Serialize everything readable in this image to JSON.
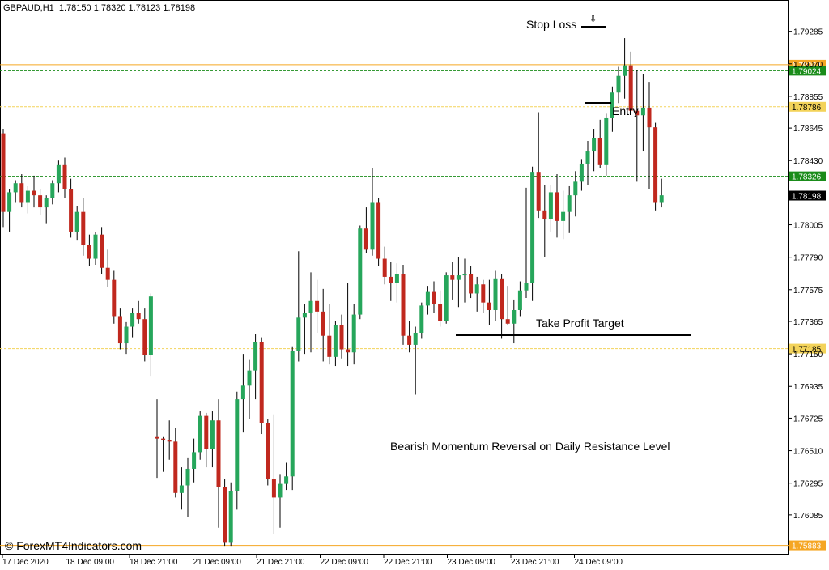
{
  "header": {
    "symbol": "GBPAUD,H1",
    "ohlc": "1.78150 1.78320 1.78123 1.78198"
  },
  "annotations": {
    "stop_loss": "Stop Loss",
    "entry": "Entry",
    "take_profit": "Take Profit Target",
    "title_note": "Bearish Momentum Reversal on Daily Resistance Level",
    "arrow": "⇩"
  },
  "copyright": "© ForexMT4Indicators.com",
  "colors": {
    "bull": "#26a65b",
    "bear": "#c0281e",
    "wick": "#000000",
    "orange_line": "#f5a623",
    "green_line": "#1a8c1a",
    "yellow_line": "#f3d35a",
    "current_bg": "#000000"
  },
  "chart_data": {
    "type": "candlestick",
    "y_axis_ticks": [
      "1.79285",
      "1.79070",
      "1.78855",
      "1.78645",
      "1.78430",
      "1.78215",
      "1.78005",
      "1.77790",
      "1.77575",
      "1.77365",
      "1.77150",
      "1.76935",
      "1.76725",
      "1.76510",
      "1.76295",
      "1.76085"
    ],
    "x_axis_labels": [
      "17 Dec 2020",
      "18 Dec 09:00",
      "18 Dec 21:00",
      "21 Dec 09:00",
      "21 Dec 21:00",
      "22 Dec 09:00",
      "22 Dec 21:00",
      "23 Dec 09:00",
      "23 Dec 21:00",
      "24 Dec 09:00"
    ],
    "ylim": [
      1.7587,
      1.7946
    ],
    "levels": [
      {
        "price": 1.79064,
        "label": "1.79064",
        "style": "orange_line"
      },
      {
        "price": 1.79024,
        "label": "1.79024",
        "style": "green_line"
      },
      {
        "price": 1.78786,
        "label": "1.78786",
        "style": "yellow_line"
      },
      {
        "price": 1.78326,
        "label": "1.78326",
        "style": "green_line"
      },
      {
        "price": 1.77185,
        "label": "1.77185",
        "style": "yellow_line"
      },
      {
        "price": 1.75883,
        "label": "1.75883",
        "style": "orange_line"
      }
    ],
    "current_price": {
      "price": 1.78198,
      "label": "1.78198"
    },
    "candles": [
      [
        1.7861,
        1.7864,
        1.7799,
        1.7809
      ],
      [
        1.7809,
        1.7824,
        1.7796,
        1.7822
      ],
      [
        1.7822,
        1.783,
        1.7815,
        1.7828
      ],
      [
        1.7828,
        1.7834,
        1.7812,
        1.7815
      ],
      [
        1.7815,
        1.7826,
        1.7808,
        1.7823
      ],
      [
        1.7823,
        1.7833,
        1.7812,
        1.782
      ],
      [
        1.782,
        1.7824,
        1.7807,
        1.7812
      ],
      [
        1.7812,
        1.782,
        1.7801,
        1.7818
      ],
      [
        1.7818,
        1.783,
        1.7814,
        1.7828
      ],
      [
        1.7828,
        1.7843,
        1.7822,
        1.784
      ],
      [
        1.784,
        1.7845,
        1.7818,
        1.7824
      ],
      [
        1.7824,
        1.7831,
        1.7792,
        1.7796
      ],
      [
        1.7796,
        1.7813,
        1.779,
        1.7809
      ],
      [
        1.7809,
        1.7818,
        1.778,
        1.7787
      ],
      [
        1.7787,
        1.7794,
        1.7773,
        1.7778
      ],
      [
        1.7778,
        1.7796,
        1.7774,
        1.7794
      ],
      [
        1.7794,
        1.7799,
        1.7768,
        1.7772
      ],
      [
        1.7772,
        1.7784,
        1.7759,
        1.7764
      ],
      [
        1.7764,
        1.777,
        1.7735,
        1.774
      ],
      [
        1.774,
        1.7745,
        1.7718,
        1.7722
      ],
      [
        1.7722,
        1.7736,
        1.7715,
        1.7733
      ],
      [
        1.7733,
        1.7745,
        1.7726,
        1.7742
      ],
      [
        1.7742,
        1.775,
        1.7735,
        1.7738
      ],
      [
        1.7738,
        1.7745,
        1.771,
        1.7714
      ],
      [
        1.7714,
        1.7755,
        1.77,
        1.7753
      ],
      [
        1.766,
        1.7685,
        1.7633,
        1.7659
      ],
      [
        1.7659,
        1.766,
        1.7637,
        1.7658
      ],
      [
        1.7658,
        1.7671,
        1.7645,
        1.7657
      ],
      [
        1.7657,
        1.7666,
        1.762,
        1.7623
      ],
      [
        1.7623,
        1.764,
        1.7612,
        1.7628
      ],
      [
        1.7628,
        1.7646,
        1.7607,
        1.7639
      ],
      [
        1.7639,
        1.7659,
        1.763,
        1.765
      ],
      [
        1.765,
        1.7677,
        1.7645,
        1.7674
      ],
      [
        1.7674,
        1.7676,
        1.764,
        1.7652
      ],
      [
        1.7652,
        1.7677,
        1.764,
        1.7671
      ],
      [
        1.7671,
        1.7685,
        1.76,
        1.7627
      ],
      [
        1.7627,
        1.7632,
        1.7588,
        1.759
      ],
      [
        1.759,
        1.763,
        1.7588,
        1.7624
      ],
      [
        1.7624,
        1.769,
        1.7612,
        1.7685
      ],
      [
        1.7685,
        1.7715,
        1.7663,
        1.7694
      ],
      [
        1.7694,
        1.7711,
        1.7672,
        1.7704
      ],
      [
        1.7704,
        1.7728,
        1.7685,
        1.7723
      ],
      [
        1.7723,
        1.7726,
        1.7662,
        1.7669
      ],
      [
        1.7669,
        1.7672,
        1.7628,
        1.7632
      ],
      [
        1.7632,
        1.7675,
        1.7596,
        1.762
      ],
      [
        1.762,
        1.7635,
        1.76,
        1.7629
      ],
      [
        1.7629,
        1.7643,
        1.7625,
        1.7634
      ],
      [
        1.7634,
        1.772,
        1.7625,
        1.7717
      ],
      [
        1.7717,
        1.7783,
        1.771,
        1.7739
      ],
      [
        1.7739,
        1.7748,
        1.7715,
        1.7742
      ],
      [
        1.7742,
        1.7769,
        1.7716,
        1.775
      ],
      [
        1.775,
        1.7764,
        1.7729,
        1.7743
      ],
      [
        1.7743,
        1.7758,
        1.771,
        1.7727
      ],
      [
        1.7727,
        1.7748,
        1.7708,
        1.7713
      ],
      [
        1.7713,
        1.7737,
        1.7707,
        1.7734
      ],
      [
        1.7734,
        1.7741,
        1.7712,
        1.7718
      ],
      [
        1.7718,
        1.7762,
        1.7707,
        1.7716
      ],
      [
        1.7716,
        1.7748,
        1.7708,
        1.7741
      ],
      [
        1.7741,
        1.78,
        1.7738,
        1.7798
      ],
      [
        1.7798,
        1.7812,
        1.7782,
        1.7784
      ],
      [
        1.7784,
        1.7838,
        1.778,
        1.7815
      ],
      [
        1.7815,
        1.7818,
        1.7773,
        1.7778
      ],
      [
        1.7778,
        1.7786,
        1.7761,
        1.7766
      ],
      [
        1.7766,
        1.7776,
        1.775,
        1.7762
      ],
      [
        1.7762,
        1.7775,
        1.7749,
        1.7768
      ],
      [
        1.7768,
        1.7774,
        1.7721,
        1.7727
      ],
      [
        1.7727,
        1.7737,
        1.7716,
        1.7721
      ],
      [
        1.7721,
        1.7733,
        1.7688,
        1.7729
      ],
      [
        1.7729,
        1.7749,
        1.7725,
        1.7747
      ],
      [
        1.7747,
        1.776,
        1.7741,
        1.7756
      ],
      [
        1.7756,
        1.7763,
        1.7742,
        1.7748
      ],
      [
        1.7748,
        1.7757,
        1.7733,
        1.7737
      ],
      [
        1.7737,
        1.7769,
        1.7735,
        1.7767
      ],
      [
        1.7767,
        1.7776,
        1.7751,
        1.7764
      ],
      [
        1.7764,
        1.7779,
        1.7746,
        1.7767
      ],
      [
        1.7767,
        1.7778,
        1.7749,
        1.7768
      ],
      [
        1.7768,
        1.7773,
        1.7752,
        1.7755
      ],
      [
        1.7755,
        1.7766,
        1.7743,
        1.7761
      ],
      [
        1.7761,
        1.7764,
        1.7742,
        1.7749
      ],
      [
        1.7749,
        1.7764,
        1.7734,
        1.7744
      ],
      [
        1.7744,
        1.777,
        1.7737,
        1.7765
      ],
      [
        1.7765,
        1.7768,
        1.7725,
        1.7738
      ],
      [
        1.7738,
        1.776,
        1.7734,
        1.7735
      ],
      [
        1.7735,
        1.7751,
        1.7722,
        1.7744
      ],
      [
        1.7744,
        1.7763,
        1.774,
        1.7757
      ],
      [
        1.7757,
        1.7825,
        1.7752,
        1.7762
      ],
      [
        1.7762,
        1.7839,
        1.775,
        1.7835
      ],
      [
        1.7835,
        1.7875,
        1.7805,
        1.781
      ],
      [
        1.781,
        1.7827,
        1.7779,
        1.7804
      ],
      [
        1.7804,
        1.7827,
        1.7796,
        1.7822
      ],
      [
        1.7822,
        1.7834,
        1.7792,
        1.7803
      ],
      [
        1.7803,
        1.7823,
        1.7791,
        1.7809
      ],
      [
        1.7809,
        1.7826,
        1.7795,
        1.782
      ],
      [
        1.782,
        1.7836,
        1.7806,
        1.7829
      ],
      [
        1.7829,
        1.7844,
        1.7823,
        1.7841
      ],
      [
        1.7841,
        1.7856,
        1.7827,
        1.7849
      ],
      [
        1.7849,
        1.7864,
        1.7836,
        1.7858
      ],
      [
        1.7858,
        1.787,
        1.7838,
        1.784
      ],
      [
        1.784,
        1.7874,
        1.7833,
        1.7871
      ],
      [
        1.7871,
        1.7892,
        1.7862,
        1.7888
      ],
      [
        1.7888,
        1.7905,
        1.7881,
        1.7899
      ],
      [
        1.7899,
        1.7924,
        1.7884,
        1.7906
      ],
      [
        1.7906,
        1.7915,
        1.7875,
        1.7876
      ],
      [
        1.7876,
        1.7903,
        1.7829,
        1.7873
      ],
      [
        1.7873,
        1.79,
        1.7849,
        1.7878
      ],
      [
        1.7878,
        1.7895,
        1.7824,
        1.7865
      ],
      [
        1.7865,
        1.7868,
        1.781,
        1.7815
      ],
      [
        1.7815,
        1.7831,
        1.7812,
        1.782
      ]
    ]
  }
}
